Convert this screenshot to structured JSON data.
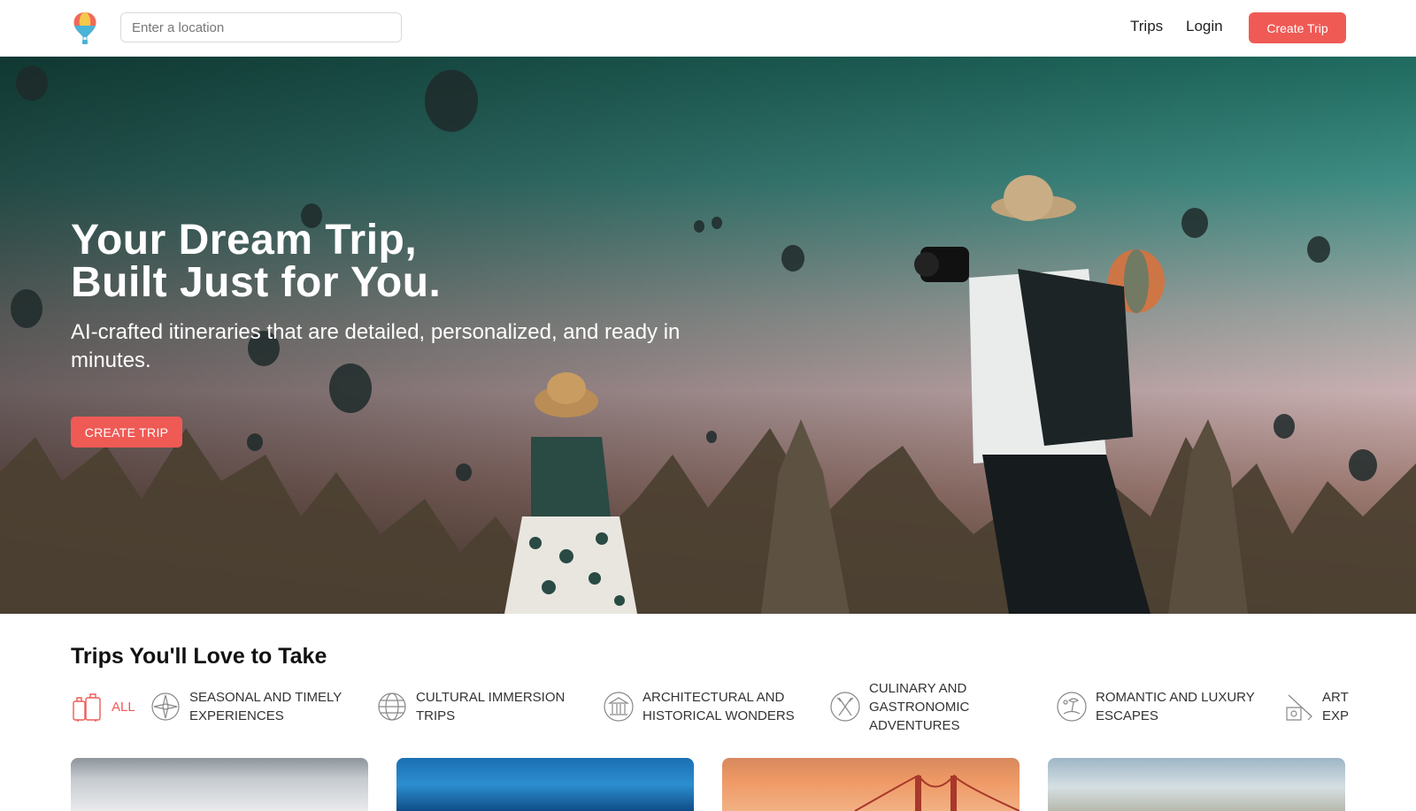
{
  "header": {
    "search_placeholder": "Enter a location",
    "nav": {
      "trips": "Trips",
      "login": "Login"
    },
    "create_button": "Create Trip"
  },
  "hero": {
    "title_line1": "Your Dream Trip,",
    "title_line2": "Built Just for You.",
    "subtitle": "AI-crafted itineraries that are detailed, personalized, and ready in minutes.",
    "cta": "CREATE TRIP"
  },
  "section": {
    "title": "Trips You'll Love to Take",
    "categories": [
      {
        "label": "ALL",
        "icon": "luggage-icon",
        "active": true
      },
      {
        "label": "SEASONAL AND TIMELY EXPERIENCES",
        "icon": "compass-icon"
      },
      {
        "label": "CULTURAL IMMERSION TRIPS",
        "icon": "globe-icon"
      },
      {
        "label": "ARCHITECTURAL AND HISTORICAL WONDERS",
        "icon": "temple-icon"
      },
      {
        "label": "CULINARY AND GASTRONOMIC ADVENTURES",
        "icon": "utensils-icon"
      },
      {
        "label": "ROMANTIC AND LUXURY ESCAPES",
        "icon": "beach-icon"
      },
      {
        "label": "ART EXP",
        "icon": "paint-icon"
      }
    ]
  },
  "colors": {
    "accent": "#ef5a55"
  }
}
